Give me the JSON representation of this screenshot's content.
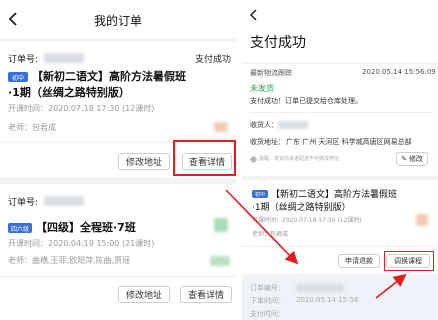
{
  "left": {
    "nav_title": "我的订单",
    "orders": [
      {
        "order_label": "订单号:",
        "status": "支付成功",
        "tag": "初中",
        "title_line1": "【新初二语文】高阶方法暑假班",
        "title_line2": "·1期（丝绸之路特别版）",
        "time": "开课时间：2020.07.18 17:30 (12课时)",
        "teacher": "老师：包君成",
        "btn_modify": "修改地址",
        "btn_detail": "查看详情"
      },
      {
        "order_label": "订单号:",
        "tag": "四六级",
        "title": "【四级】全程班·7班",
        "time": "开课时间：2020.04.19 15:00 (21课时)",
        "teacher": "老师：曲横,王菲,欧阳萍,陈曲,贾瑶",
        "btn_modify": "修改地址",
        "btn_detail": "查看详情"
      }
    ]
  },
  "right": {
    "title": "支付成功",
    "logistics_label": "最新物流跟踪",
    "logistics_time": "2020.05.14 15:56:09",
    "ship_status": "未发货",
    "ship_message": "支付成功！订单已提交给仓库处理。",
    "receiver_label": "收货人：",
    "address_label": "收货地址：",
    "address_value": "广东 广州 天河区 科学城高唐区网易总部",
    "address_tip": "提醒：发货前承诺配送不可修改地址",
    "btn_modify": "修改",
    "course_tag": "初中",
    "course_title_line1": "【新初二语文】高阶方法暑假班",
    "course_title_line2": "·1期（丝绸之路特别版）",
    "course_time": "开课时间：2020.07.18 17:30 (12课时)",
    "course_teacher": "老师：包君成",
    "btn_refund": "申请退款",
    "btn_change": "调换课程",
    "order_no_label": "订单编号：",
    "order_time_label": "下单时间：",
    "order_time_value": "2020.05.14 15:56",
    "pay_time_label": "支付时间："
  },
  "colors": {
    "highlight": "#e02020",
    "success_green": "#2aa34a",
    "tag_blue": "#3a6fd8"
  }
}
